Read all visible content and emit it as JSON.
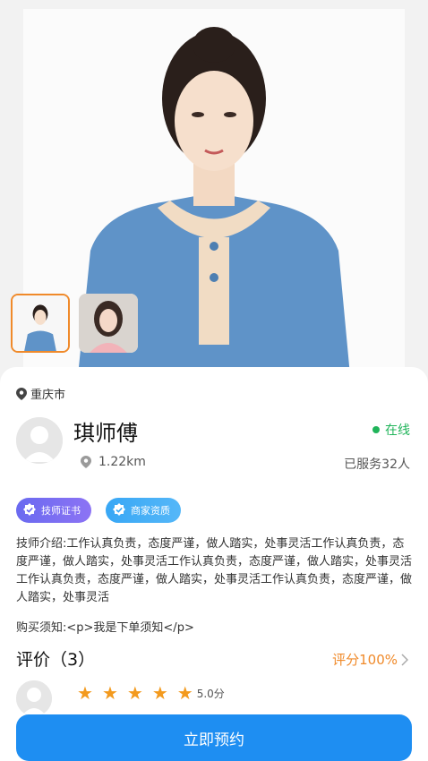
{
  "location": {
    "city": "重庆市",
    "icon": "location-pin-icon"
  },
  "therapist": {
    "name": "琪师傅",
    "status": "在线",
    "distance": "1.22km",
    "served": "已服务32人"
  },
  "badges": [
    {
      "label": "技师证书",
      "icon": "verified-check-icon"
    },
    {
      "label": "商家资质",
      "icon": "verified-check-icon"
    }
  ],
  "intro": "技师介绍:工作认真负责，态度严谨，做人踏实，处事灵活工作认真负责，态度严谨，做人踏实，处事灵活工作认真负责，态度严谨，做人踏实，处事灵活工作认真负责，态度严谨，做人踏实，处事灵活工作认真负责，态度严谨，做人踏实，处事灵活",
  "notice": "购买须知:<p>我是下单须知</p>",
  "reviews": {
    "title": "评价（3）",
    "score": "评分100%",
    "first_rating": "5.0分",
    "stars": 5
  },
  "book_button": "立即预约",
  "colors": {
    "accent": "#1e8ef2",
    "orange": "#f08a2a",
    "online": "#20b45a",
    "star": "#f39a1e"
  }
}
